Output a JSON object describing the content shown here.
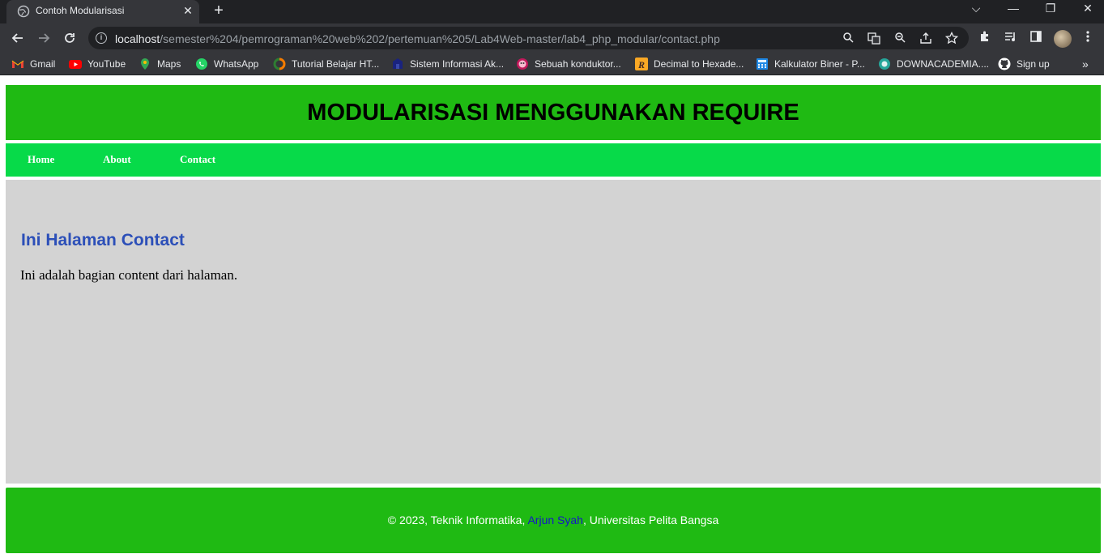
{
  "browser": {
    "tab": {
      "title": "Contoh Modularisasi",
      "close_glyph": "✕"
    },
    "new_tab_glyph": "+",
    "window_controls": {
      "tabsearch": "⌵",
      "minimize": "—",
      "restore": "❐",
      "close": "✕"
    },
    "url_host": "localhost",
    "url_path": "/semester%204/pemrograman%20web%202/pertemuan%205/Lab4Web-master/lab4_php_modular/contact.php",
    "bookmarks": [
      {
        "label": "Gmail",
        "icon": "gmail-icon",
        "color": "#ea4335"
      },
      {
        "label": "YouTube",
        "icon": "youtube-icon",
        "color": "#ff0000"
      },
      {
        "label": "Maps",
        "icon": "maps-icon",
        "color": "#34a853"
      },
      {
        "label": "WhatsApp",
        "icon": "whatsapp-icon",
        "color": "#25d366"
      },
      {
        "label": "Tutorial Belajar HT...",
        "icon": "tutorial-icon",
        "color": "#2e7d32"
      },
      {
        "label": "Sistem Informasi Ak...",
        "icon": "sia-icon",
        "color": "#1a237e"
      },
      {
        "label": "Sebuah konduktor...",
        "icon": "konduktor-icon",
        "color": "#c2185b"
      },
      {
        "label": "Decimal to Hexade...",
        "icon": "rapidtables-icon",
        "color": "#f9a825"
      },
      {
        "label": "Kalkulator Biner - P...",
        "icon": "calculator-icon",
        "color": "#1e88e5"
      },
      {
        "label": "DOWNACADEMIA....",
        "icon": "downacademia-icon",
        "color": "#26a69a"
      },
      {
        "label": "Sign up",
        "icon": "github-icon",
        "color": "#ffffff"
      }
    ],
    "bookmarks_more": "»"
  },
  "site": {
    "header_title": "MODULARISASI MENGGUNAKAN REQUIRE",
    "nav": [
      {
        "label": "Home"
      },
      {
        "label": "About"
      },
      {
        "label": "Contact"
      }
    ],
    "content": {
      "heading": "Ini Halaman Contact",
      "paragraph": "Ini adalah bagian content dari halaman."
    },
    "footer": {
      "prefix": "© 2023, Teknik Informatika, ",
      "author": "Arjun Syah",
      "suffix": ", Universitas Pelita Bangsa"
    },
    "colors": {
      "header_bg": "#1fba13",
      "nav_bg": "#07da49",
      "content_bg": "#d3d3d3",
      "heading_color": "#2c4fb8",
      "link_color": "#1515c8"
    }
  }
}
